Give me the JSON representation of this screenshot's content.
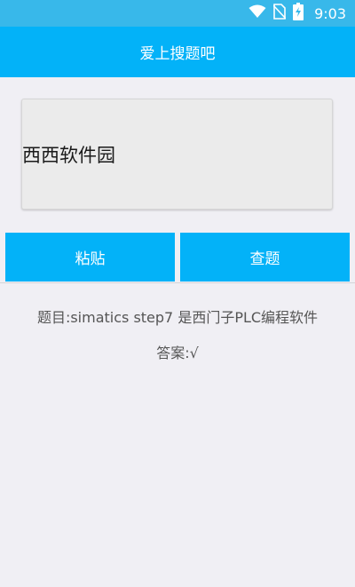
{
  "status_bar": {
    "time": "9:03",
    "icons": [
      "wifi-icon",
      "no-sim-icon",
      "battery-charging-icon"
    ],
    "color": "#38b8ea"
  },
  "app_bar": {
    "title": "爱上搜题吧",
    "color": "#03b2f8"
  },
  "search_input": {
    "value": "西西软件园"
  },
  "buttons": {
    "paste_label": "粘贴",
    "search_label": "查题"
  },
  "result": {
    "question": "题目:simatics step7 是西门子PLC编程软件",
    "answer": "答案:√"
  }
}
